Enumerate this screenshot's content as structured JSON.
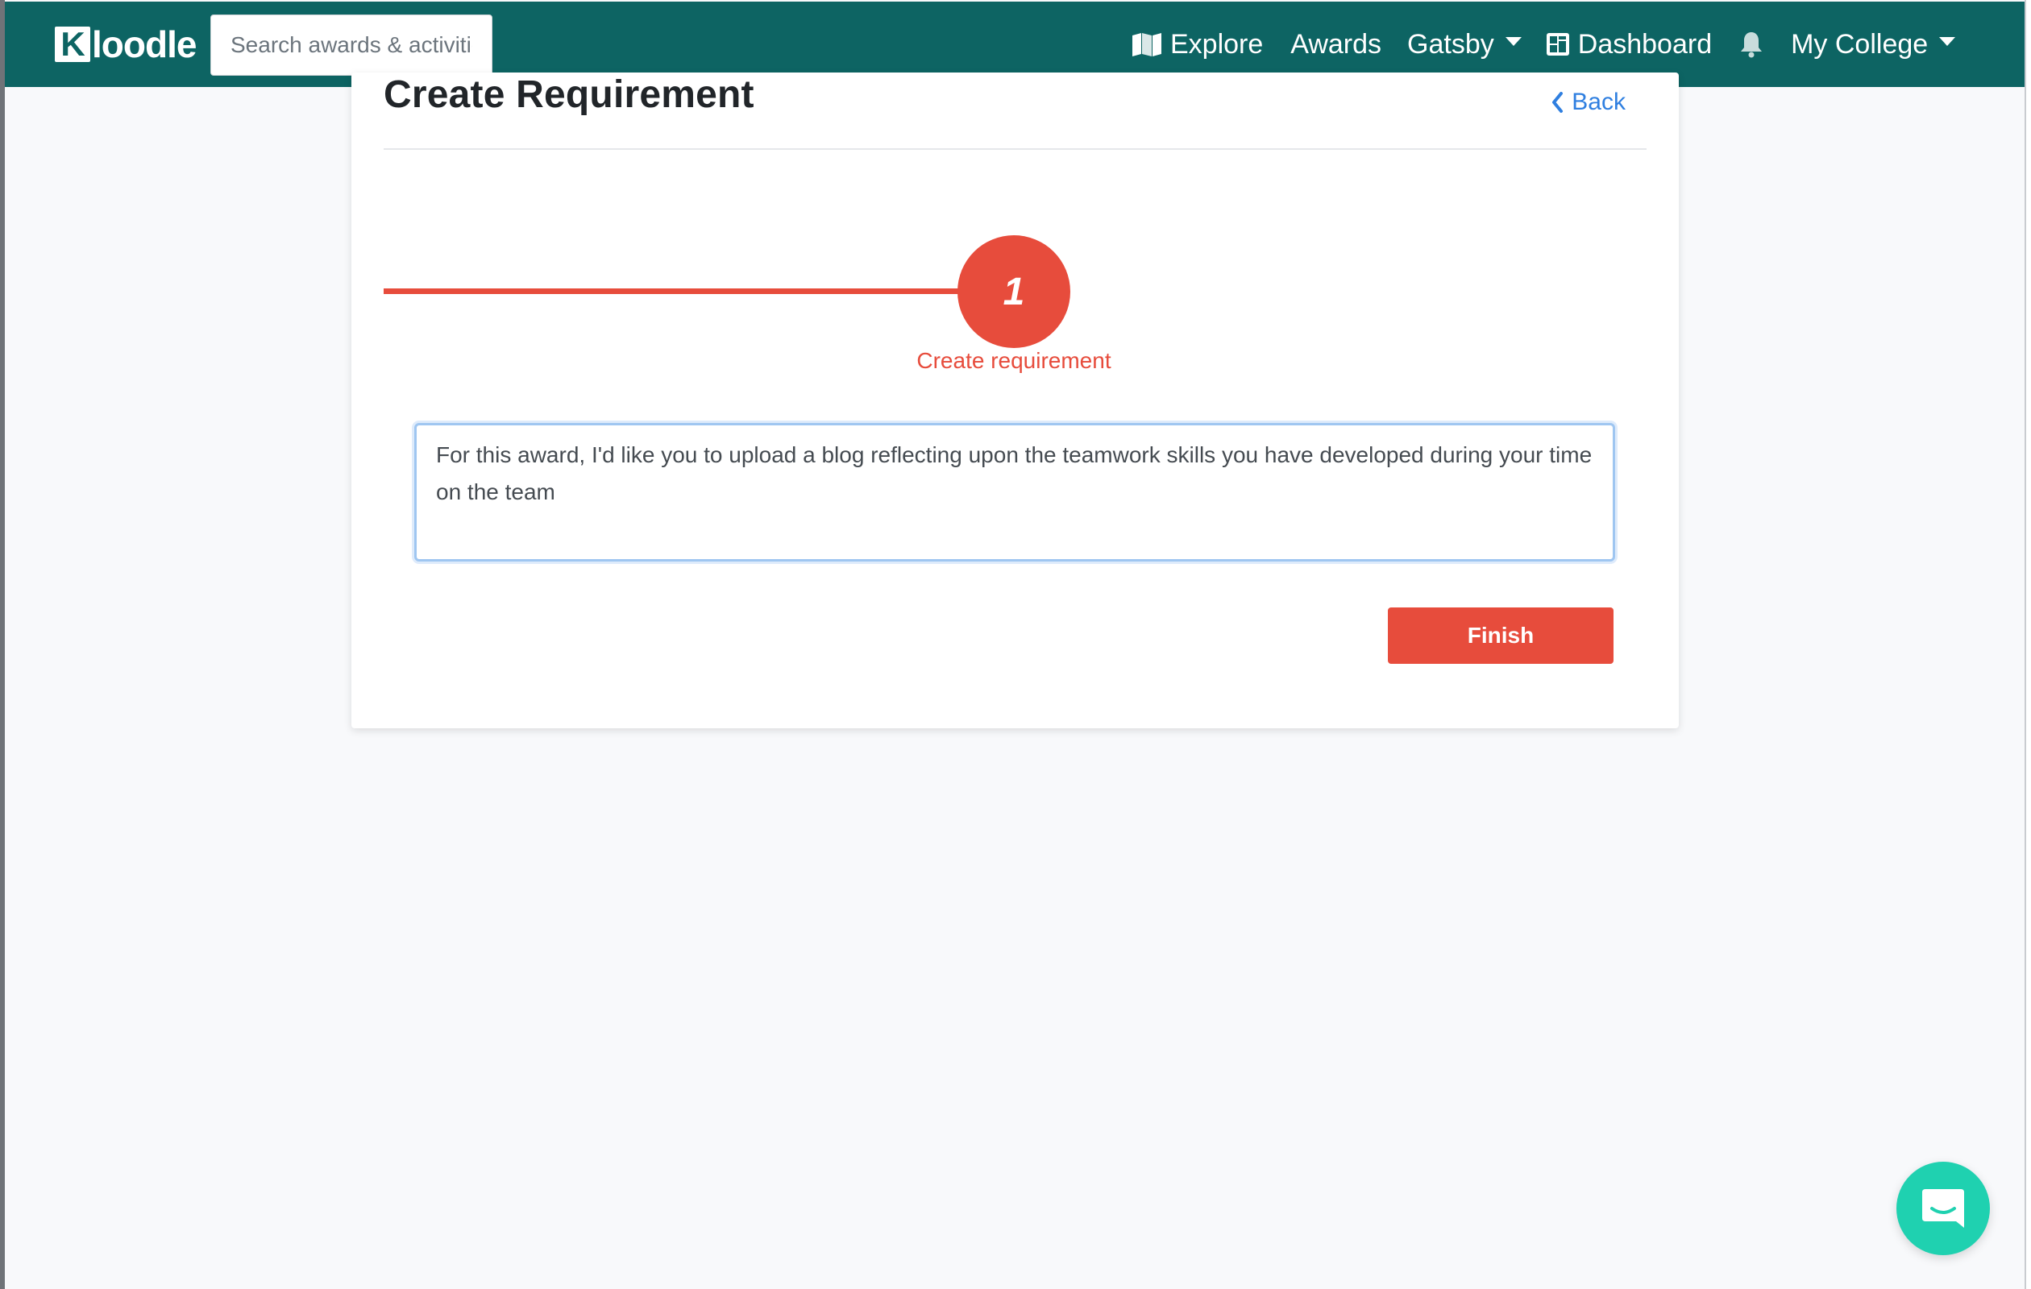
{
  "brand": {
    "logo_text": "Kloodle"
  },
  "search": {
    "placeholder": "Search awards & activities"
  },
  "nav": {
    "explore": "Explore",
    "awards": "Awards",
    "gatsby": "Gatsby",
    "dashboard": "Dashboard",
    "college": "My College"
  },
  "page": {
    "title": "Create Requirement",
    "back": "Back"
  },
  "stepper": {
    "step_number": "1",
    "step_label": "Create requirement"
  },
  "requirement": {
    "text": "For this award, I'd like you to upload a blog reflecting upon the teamwork skills you have developed during your time on the team"
  },
  "actions": {
    "finish": "Finish"
  },
  "colors": {
    "navbar": "#0d6463",
    "accent": "#e74c3c",
    "link": "#2f7fe0",
    "chat": "#1fd1b0"
  }
}
